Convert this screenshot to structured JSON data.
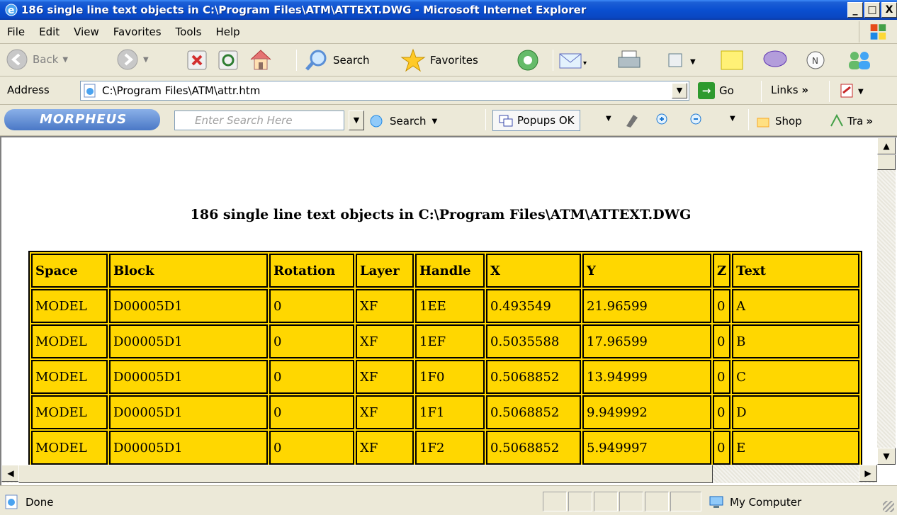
{
  "window": {
    "title": "186 single line text objects in C:\\Program Files\\ATM\\ATTEXT.DWG - Microsoft Internet Explorer",
    "controls": [
      "_",
      "□",
      "X"
    ]
  },
  "menu": [
    "File",
    "Edit",
    "View",
    "Favorites",
    "Tools",
    "Help"
  ],
  "toolbar": {
    "back_label": "Back",
    "search_label": "Search",
    "favorites_label": "Favorites"
  },
  "address": {
    "label": "Address",
    "url": "C:\\Program Files\\ATM\\attr.htm",
    "go_label": "Go",
    "links_label": "Links"
  },
  "morpheus": {
    "logo": "MORPHEUS",
    "search_placeholder": "Enter Search Here",
    "search_label": "Search",
    "popups_label": "Popups OK",
    "shop_label": "Shop",
    "tra_label": "Tra"
  },
  "page": {
    "heading": "186 single line text objects in C:\\Program Files\\ATM\\ATTEXT.DWG",
    "columns": [
      "Space",
      "Block",
      "Rotation",
      "Layer",
      "Handle",
      "X",
      "Y",
      "Z",
      "Text"
    ],
    "rows": [
      [
        "MODEL",
        "D00005D1",
        "0",
        "XF",
        "1EE",
        "0.493549",
        "21.96599",
        "0",
        "A"
      ],
      [
        "MODEL",
        "D00005D1",
        "0",
        "XF",
        "1EF",
        "0.5035588",
        "17.96599",
        "0",
        "B"
      ],
      [
        "MODEL",
        "D00005D1",
        "0",
        "XF",
        "1F0",
        "0.5068852",
        "13.94999",
        "0",
        "C"
      ],
      [
        "MODEL",
        "D00005D1",
        "0",
        "XF",
        "1F1",
        "0.5068852",
        "9.949992",
        "0",
        "D"
      ],
      [
        "MODEL",
        "D00005D1",
        "0",
        "XF",
        "1F2",
        "0.5068852",
        "5.949997",
        "0",
        "E"
      ]
    ]
  },
  "status": {
    "text": "Done",
    "zone": "My Computer"
  },
  "colors": {
    "table_bg": "#ffd700",
    "title_bar": "#0a47c2"
  }
}
